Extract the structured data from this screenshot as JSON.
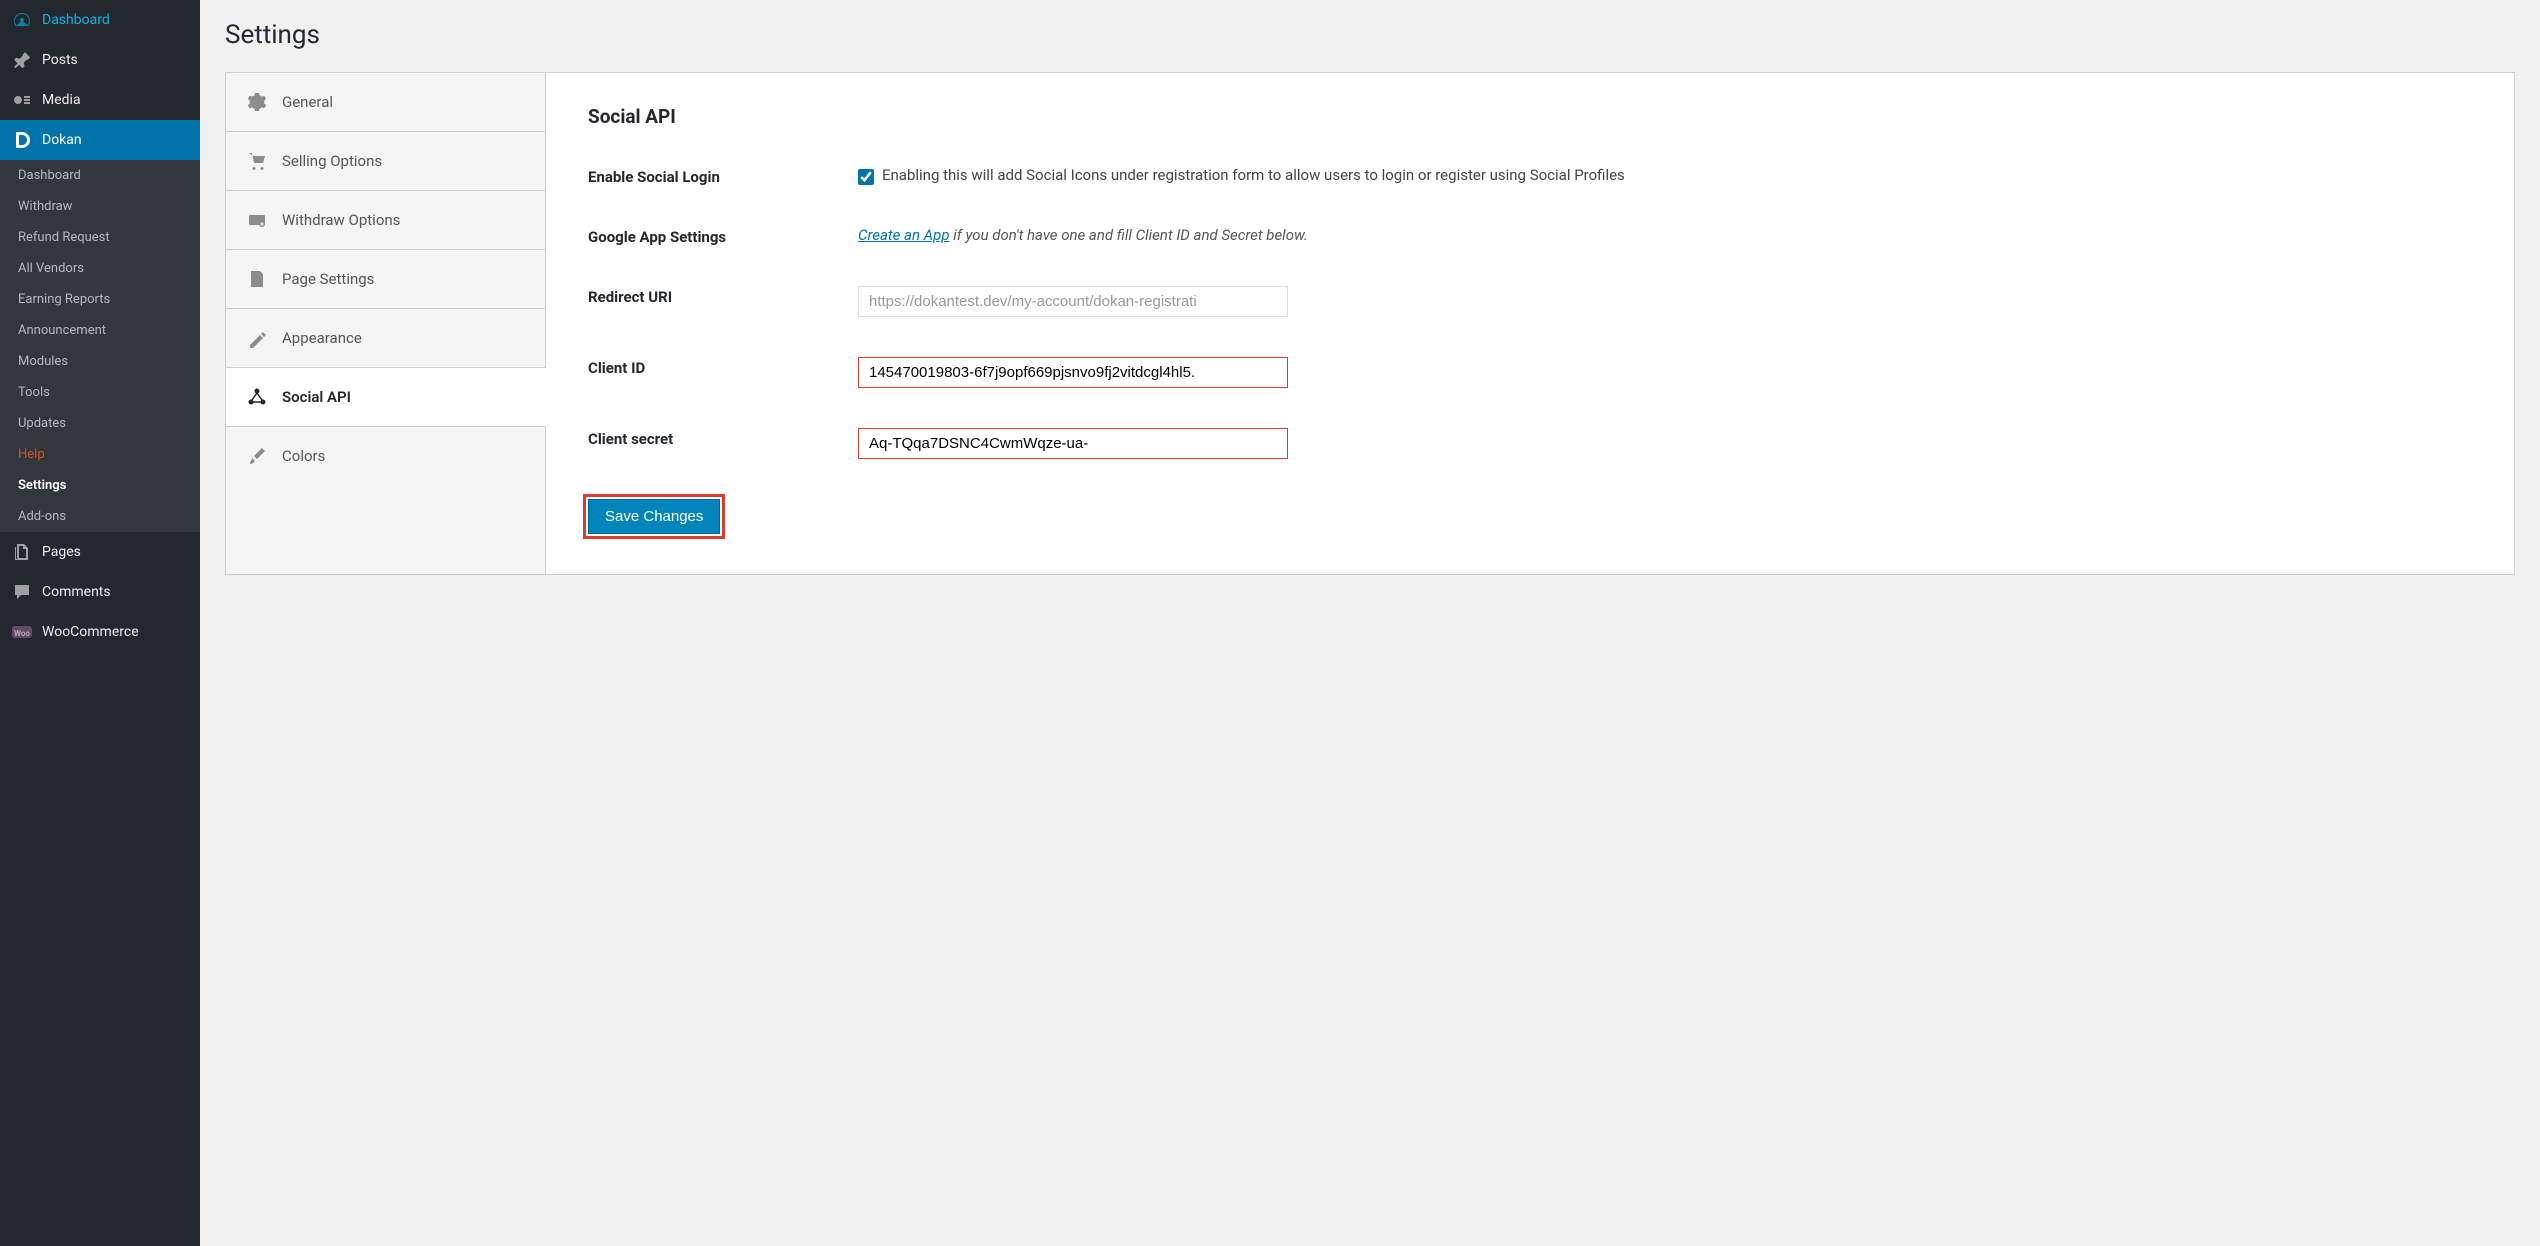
{
  "sidebar": {
    "items": [
      {
        "label": "Dashboard",
        "icon": "dashboard-icon"
      },
      {
        "label": "Posts",
        "icon": "pin-icon"
      },
      {
        "label": "Media",
        "icon": "media-icon"
      },
      {
        "label": "Dokan",
        "icon": "dokan-icon",
        "active": true
      },
      {
        "label": "Pages",
        "icon": "pages-icon"
      },
      {
        "label": "Comments",
        "icon": "comment-icon"
      },
      {
        "label": "WooCommerce",
        "icon": "woo-icon"
      }
    ],
    "submenu": [
      {
        "label": "Dashboard"
      },
      {
        "label": "Withdraw"
      },
      {
        "label": "Refund Request"
      },
      {
        "label": "All Vendors"
      },
      {
        "label": "Earning Reports"
      },
      {
        "label": "Announcement"
      },
      {
        "label": "Modules"
      },
      {
        "label": "Tools"
      },
      {
        "label": "Updates"
      },
      {
        "label": "Help",
        "highlight": true
      },
      {
        "label": "Settings",
        "bold": true
      },
      {
        "label": "Add-ons"
      }
    ]
  },
  "page": {
    "title": "Settings"
  },
  "tabs": [
    {
      "label": "General",
      "icon": "gear-icon"
    },
    {
      "label": "Selling Options",
      "icon": "cart-icon"
    },
    {
      "label": "Withdraw Options",
      "icon": "withdraw-icon"
    },
    {
      "label": "Page Settings",
      "icon": "page-icon"
    },
    {
      "label": "Appearance",
      "icon": "appearance-icon"
    },
    {
      "label": "Social API",
      "icon": "network-icon",
      "active": true
    },
    {
      "label": "Colors",
      "icon": "brush-icon"
    }
  ],
  "panel": {
    "title": "Social API",
    "enable_label": "Enable Social Login",
    "enable_checked": true,
    "enable_desc": "Enabling this will add Social Icons under registration form to allow users to login or register using Social Profiles",
    "google_label": "Google App Settings",
    "create_link_text": "Create an App",
    "create_desc": " if you don't have one and fill Client ID and Secret below.",
    "redirect_label": "Redirect URI",
    "redirect_value": "https://dokantest.dev/my-account/dokan-registrati",
    "client_id_label": "Client ID",
    "client_id_value": "145470019803-6f7j9opf669pjsnvo9fj2vitdcgl4hl5.",
    "client_secret_label": "Client secret",
    "client_secret_value": "Aq-TQqa7DSNC4CwmWqze-ua-",
    "save_button": "Save Changes"
  }
}
